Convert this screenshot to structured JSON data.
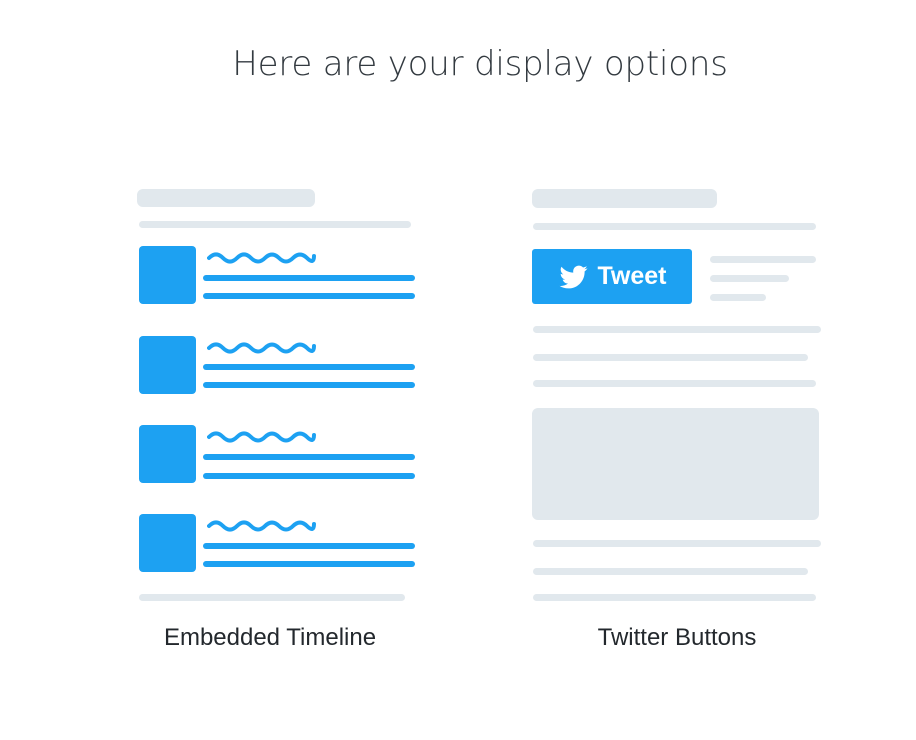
{
  "title": "Here are your display options",
  "options": [
    {
      "label": "Embedded Timeline",
      "icon": "timeline-preview"
    },
    {
      "label": "Twitter Buttons",
      "icon": "buttons-preview",
      "button_label": "Tweet"
    }
  ],
  "colors": {
    "accent": "#1da1f2",
    "placeholder": "#e1e8ed",
    "text": "#23282d"
  }
}
